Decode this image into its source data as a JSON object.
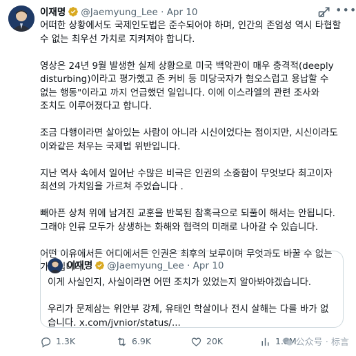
{
  "tweet": {
    "author_name": "이재명",
    "handle": "@Jaemyung_Lee",
    "separator": "·",
    "date": "Apr 10",
    "paragraphs": [
      "어떠한 상황에서도 국제인도법은 준수되어야 하며, 인간의 존엄성 역시 타협할 수 없는 최우선 가치로 지켜져야 합니다.",
      "영상은 24년 9월 발생한 실제 상황으로 미국 백악관이 매우 충격적(deeply disturbing)이라고 평가했고 존 커비 등 미당국자가 혐오스럽고 용납할 수 없는 행동\"이라고 까지 언급했던 일입니다. 이에 이스라엘의 관련 조사와 조치도 이루어졌다고 합니다.",
      "조금 다행이라면 살아있는 사람이 아니라 시신이었다는 점이지만, 시신이라도 이와같은 처우는 국제법 위반입니다.",
      "지난 역사 속에서 일어난 수많은 비극은 인권의 소중함이 무엇보다 최고이자 최선의 가치임을 가르쳐 주었습니다 .",
      "빼아픈 상처 위에 남겨진 교훈을 반복된 참혹극으로 되풀이 해서는 안됩니다. 그래야 인류 모두가 상생하는 화해와 협력의 미래로 나아갈 수 있습니다.",
      "어떤 이유에서든 어디에서든 인권은 최후의 보루이며 무엇과도 바꿀 수 없는 가치입니다."
    ]
  },
  "quote": {
    "author_name": "이재명",
    "handle": "@Jaemyung_Lee",
    "separator": "·",
    "date": "Apr 10",
    "line1": "이게 사실인지, 사실이라면 어떤 조치가 있었는지 알아봐야겠습니다.",
    "line2": "우리가 문제삼는 위안부 강제, 유태인 학살이나 전시 살해는 다를 바가 없습니다. x.com/jvnior/status/..."
  },
  "actions": {
    "replies": "1.3K",
    "reposts": "6.9K",
    "likes": "20K",
    "views": "1.8M"
  },
  "watermark": {
    "text": "公众号 · 标言"
  },
  "icons": {
    "reply": "reply-icon",
    "repost": "repost-icon",
    "like": "heart-icon",
    "views": "views-icon",
    "grok": "grok-icon",
    "more": "more-icon",
    "verified": "verified-badge-icon"
  },
  "colors": {
    "verified_gold": "#d9a920",
    "muted": "#536471",
    "border": "#cfd9de"
  }
}
